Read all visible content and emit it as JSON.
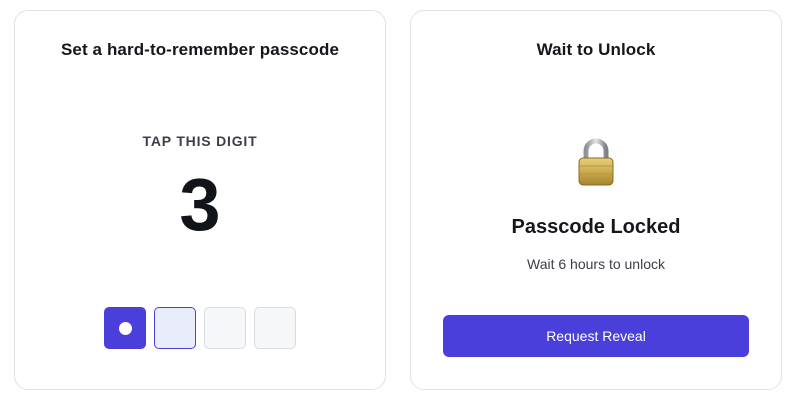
{
  "setup_card": {
    "title": "Set a hard-to-remember passcode",
    "caption": "TAP THIS DIGIT",
    "digit": "3",
    "slots": [
      {
        "state": "filled"
      },
      {
        "state": "active"
      },
      {
        "state": "empty"
      },
      {
        "state": "empty"
      }
    ]
  },
  "unlock_card": {
    "title": "Wait to Unlock",
    "icon": "padlock-icon",
    "status_title": "Passcode Locked",
    "status_subtitle": "Wait 6 hours to unlock",
    "button_label": "Request Reveal"
  },
  "colors": {
    "accent": "#4a3fdb",
    "slot_active_bg": "#e9ecfb",
    "slot_empty_bg": "#f6f7f9",
    "border": "#dfe1e6"
  }
}
